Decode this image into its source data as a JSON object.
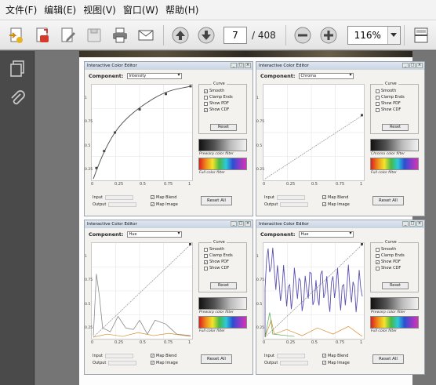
{
  "menu": [
    {
      "label": "文件(F)"
    },
    {
      "label": "编辑(E)"
    },
    {
      "label": "视图(V)"
    },
    {
      "label": "窗口(W)"
    },
    {
      "label": "帮助(H)"
    }
  ],
  "toolbar": {
    "page_current": "7",
    "page_total": "/ 408",
    "zoom": "116%"
  },
  "windows": [
    {
      "title": "Interactive Color Editor",
      "component_label": "Component:",
      "component_value": "Intensity",
      "curve_legend": "Curve",
      "options": [
        {
          "label": "Smooth",
          "checked": true
        },
        {
          "label": "Clamp Ends",
          "checked": false
        },
        {
          "label": "Show PDF",
          "checked": false
        },
        {
          "label": "Show CDF",
          "checked": true
        }
      ],
      "reset_label": "Reset",
      "grad_label": "Prewarp color filter",
      "rainbow_label": "Full color filter",
      "input_label": "Input",
      "output_label": "Output",
      "map_blend": "Map Blend",
      "map_image": "Map Image",
      "reset_all": "Reset All",
      "xticks": [
        "0",
        "0.25",
        "0.5",
        "0.75",
        "1"
      ],
      "yticks": [
        "1",
        "0.75",
        "0.5",
        "0.25"
      ]
    },
    {
      "title": "Interactive Color Editor",
      "component_label": "Component:",
      "component_value": "Chroma",
      "curve_legend": "Curve",
      "options": [
        {
          "label": "Smooth",
          "checked": false
        },
        {
          "label": "Clamp Ends",
          "checked": false
        },
        {
          "label": "Show PDF",
          "checked": false
        },
        {
          "label": "Show CDF",
          "checked": false
        }
      ],
      "reset_label": "Reset",
      "grad_label": "Chroma color filter",
      "rainbow_label": "Full color filter",
      "input_label": "Input",
      "output_label": "Output",
      "map_blend": "Map Blend",
      "map_image": "Map Image",
      "reset_all": "Reset All",
      "xticks": [
        "0",
        "0.25",
        "0.5",
        "0.75",
        "1"
      ],
      "yticks": [
        "1",
        "0.75",
        "0.5",
        "0.25"
      ]
    },
    {
      "title": "Interactive Color Editor",
      "component_label": "Component:",
      "component_value": "Hue",
      "curve_legend": "Curve",
      "options": [
        {
          "label": "Smooth",
          "checked": false
        },
        {
          "label": "Clamp Ends",
          "checked": false
        },
        {
          "label": "Show PDF",
          "checked": true
        },
        {
          "label": "Show CDF",
          "checked": false
        }
      ],
      "reset_label": "Reset",
      "grad_label": "Prewarp color filter",
      "rainbow_label": "Full color filter",
      "input_label": "Input",
      "output_label": "Output",
      "map_blend": "Map Blend",
      "map_image": "Map Image",
      "reset_all": "Reset All",
      "xticks": [
        "0",
        "0.25",
        "0.5",
        "0.75",
        "1"
      ],
      "yticks": [
        "1",
        "0.75",
        "0.5",
        "0.25"
      ]
    },
    {
      "title": "Interactive Color Editor",
      "component_label": "Component:",
      "component_value": "Hue",
      "curve_legend": "Curve",
      "options": [
        {
          "label": "Smooth",
          "checked": false
        },
        {
          "label": "Clamp Ends",
          "checked": false
        },
        {
          "label": "Show PDF",
          "checked": true
        },
        {
          "label": "Show CDF",
          "checked": false
        }
      ],
      "reset_label": "Reset",
      "grad_label": "Prewarp color filter",
      "rainbow_label": "Full color filter",
      "input_label": "Input",
      "output_label": "Output",
      "map_blend": "Map Blend",
      "map_image": "Map Image",
      "reset_all": "Reset All",
      "xticks": [
        "0",
        "0.25",
        "0.5",
        "0.75",
        "1"
      ],
      "yticks": [
        "1",
        "0.75",
        "0.5",
        "0.25"
      ]
    }
  ]
}
